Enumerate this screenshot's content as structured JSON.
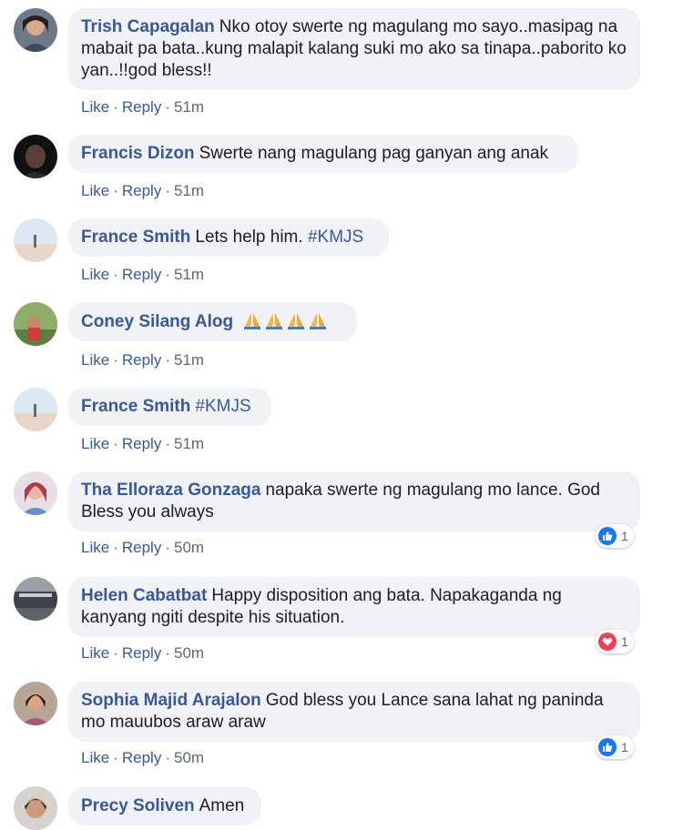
{
  "actions": {
    "like": "Like",
    "reply": "Reply",
    "separator": "·"
  },
  "colors": {
    "link": "#385898",
    "bubble": "#f0f2f5",
    "like_blue": "#1877f2",
    "love_red": "#f33e58"
  },
  "comments": [
    {
      "author": "Trish Capagalan",
      "text": "Nko otoy swerte ng magulang mo sayo..masipag na mabait pa bata..kung malapit kalang suki mo ako sa tinapa..paborito ko yan..!!god bless!!",
      "time": "51m"
    },
    {
      "author": "Francis Dizon",
      "text": "Swerte nang magulang pag ganyan ang anak",
      "time": "51m"
    },
    {
      "author": "France Smith",
      "text": "Lets help him. ",
      "hashtag": "#KMJS",
      "time": "51m"
    },
    {
      "author": "Coney Silang Alog",
      "emoji": "folded-hands-icon",
      "emoji_count": 4,
      "time": "51m"
    },
    {
      "author": "France Smith",
      "text": "",
      "hashtag": "#KMJS",
      "time": "51m"
    },
    {
      "author": "Tha Elloraza Gonzaga",
      "text": "napaka swerte ng magulang mo lance. God Bless you always",
      "time": "50m",
      "reaction": {
        "icon": "like-icon",
        "count": "1"
      }
    },
    {
      "author": "Helen Cabatbat",
      "text": "Happy disposition ang bata. Napakaganda ng kanyang ngiti despite his situation.",
      "time": "50m",
      "reaction": {
        "icon": "love-icon",
        "count": "1"
      }
    },
    {
      "author": "Sophia Majid Arajalon",
      "text": "God bless you Lance sana lahat ng paninda mo mauubos araw araw",
      "time": "50m",
      "reaction": {
        "icon": "like-icon",
        "count": "1"
      }
    },
    {
      "author": "Precy Soliven",
      "text": "Amen"
    }
  ]
}
